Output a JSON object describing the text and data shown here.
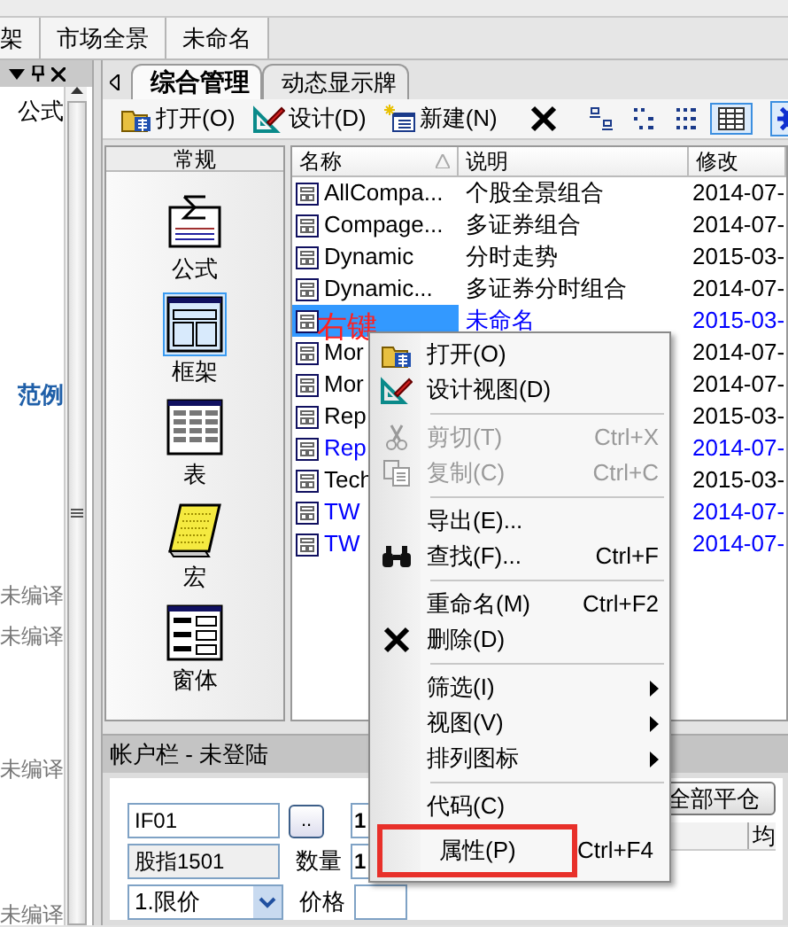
{
  "top_tabs": [
    {
      "label": "架"
    },
    {
      "label": "市场全景"
    },
    {
      "label": "未命名"
    }
  ],
  "formula_panel": {
    "entries": [
      {
        "text": "公式",
        "kind": "plain"
      },
      {
        "text": "范例",
        "kind": "group"
      },
      {
        "text": "未编译",
        "kind": "note"
      },
      {
        "text": "未编译",
        "kind": "note"
      },
      {
        "text": "未编译",
        "kind": "note"
      },
      {
        "text": "未编译",
        "kind": "note"
      }
    ]
  },
  "doc_tabs": [
    {
      "label": "综合管理",
      "selected": true
    },
    {
      "label": "动态显示牌",
      "selected": false
    }
  ],
  "toolbar": [
    {
      "kind": "open",
      "label": "打开(O)"
    },
    {
      "kind": "design",
      "label": "设计(D)"
    },
    {
      "kind": "new",
      "label": "新建(N)"
    },
    {
      "kind": "delete"
    },
    {
      "kind": "large",
      "selected": false
    },
    {
      "kind": "small",
      "selected": false
    },
    {
      "kind": "list",
      "selected": false
    },
    {
      "kind": "details",
      "selected": true
    },
    {
      "kind": "settings",
      "selected": true
    }
  ],
  "categories": {
    "title": "常规",
    "items": [
      {
        "label": "公式",
        "kind": "formula",
        "selected": false
      },
      {
        "label": "框架",
        "kind": "frame",
        "selected": true
      },
      {
        "label": "表",
        "kind": "table",
        "selected": false
      },
      {
        "label": "宏",
        "kind": "macro",
        "selected": false
      },
      {
        "label": "窗体",
        "kind": "form",
        "selected": false
      }
    ]
  },
  "list": {
    "columns": [
      {
        "label": "名称",
        "sorted": true
      },
      {
        "label": "说明",
        "sorted": false
      },
      {
        "label": "修改",
        "sorted": false
      }
    ],
    "rows": [
      {
        "name": "AllCompa...",
        "description": "个股全景组合",
        "modified": "2014-07-",
        "color": "#000000",
        "selected": false
      },
      {
        "name": "Compage...",
        "description": "多证券组合",
        "modified": "2014-07-",
        "color": "#000000",
        "selected": false
      },
      {
        "name": "Dynamic",
        "description": "分时走势",
        "modified": "2015-03-",
        "color": "#000000",
        "selected": false
      },
      {
        "name": "Dynamic...",
        "description": "多证券分时组合",
        "modified": "2014-07-",
        "color": "#000000",
        "selected": false
      },
      {
        "description": "未命名",
        "modified": "2015-03-",
        "color": "#0000ff",
        "selected": true
      },
      {
        "name": "Mor",
        "modified": "2014-07-",
        "color": "#000000",
        "selected": false
      },
      {
        "name": "Mor",
        "modified": "2014-07-",
        "color": "#000000",
        "selected": false
      },
      {
        "name": "Rep",
        "modified": "2015-03-",
        "color": "#000000",
        "selected": false
      },
      {
        "name": "Rep",
        "modified": "2014-07-",
        "color": "#0000ff",
        "selected": false
      },
      {
        "name": "Tech",
        "modified": "2015-03-",
        "color": "#000000",
        "selected": false
      },
      {
        "name": "TW",
        "modified": "2014-07-",
        "color": "#0000ff",
        "selected": false
      },
      {
        "name": "TW",
        "modified": "2014-07-",
        "color": "#0000ff",
        "selected": false
      }
    ]
  },
  "context_menu": {
    "items": [
      {
        "kind": "open",
        "label": "打开(O)",
        "disabled": false,
        "submenu": false,
        "highlighted": false
      },
      {
        "kind": "design",
        "label": "设计视图(D)",
        "disabled": false,
        "submenu": false,
        "highlighted": false
      },
      {
        "kind": "separator"
      },
      {
        "kind": "cut",
        "label": "剪切(T)",
        "shortcut": "Ctrl+X",
        "disabled": true,
        "submenu": false,
        "highlighted": false
      },
      {
        "kind": "copy",
        "label": "复制(C)",
        "shortcut": "Ctrl+C",
        "disabled": true,
        "submenu": false,
        "highlighted": false
      },
      {
        "kind": "separator"
      },
      {
        "kind": "plain",
        "label": "导出(E)...",
        "disabled": false,
        "submenu": false,
        "highlighted": false
      },
      {
        "kind": "find",
        "label": "查找(F)...",
        "shortcut": "Ctrl+F",
        "disabled": false,
        "submenu": false,
        "highlighted": false
      },
      {
        "kind": "separator"
      },
      {
        "kind": "plain",
        "label": "重命名(M)",
        "shortcut": "Ctrl+F2",
        "disabled": false,
        "submenu": false,
        "highlighted": false
      },
      {
        "kind": "delete",
        "label": "删除(D)",
        "disabled": false,
        "submenu": false,
        "highlighted": false
      },
      {
        "kind": "separator"
      },
      {
        "kind": "plain",
        "label": "筛选(I)",
        "disabled": false,
        "submenu": true,
        "highlighted": false
      },
      {
        "kind": "plain",
        "label": "视图(V)",
        "disabled": false,
        "submenu": true,
        "highlighted": false
      },
      {
        "kind": "plain",
        "label": "排列图标",
        "disabled": false,
        "submenu": true,
        "highlighted": false
      },
      {
        "kind": "separator"
      },
      {
        "kind": "plain",
        "label": "代码(C)",
        "disabled": false,
        "submenu": false,
        "highlighted": false
      },
      {
        "kind": "plain",
        "label": "属性(P)",
        "shortcut": "Ctrl+F4",
        "disabled": false,
        "submenu": false,
        "highlighted": true
      }
    ]
  },
  "callout": "右键",
  "account_panel": {
    "title": "帐户栏 - 未登陆",
    "code": "IF01",
    "browse": "..",
    "top_right_value": "1",
    "name": "股指1501",
    "quantity_label": "数量",
    "quantity": "1",
    "order_type": "1.限价",
    "price_label": "价格",
    "close_all": "全部平仓",
    "grid_column": "均"
  }
}
